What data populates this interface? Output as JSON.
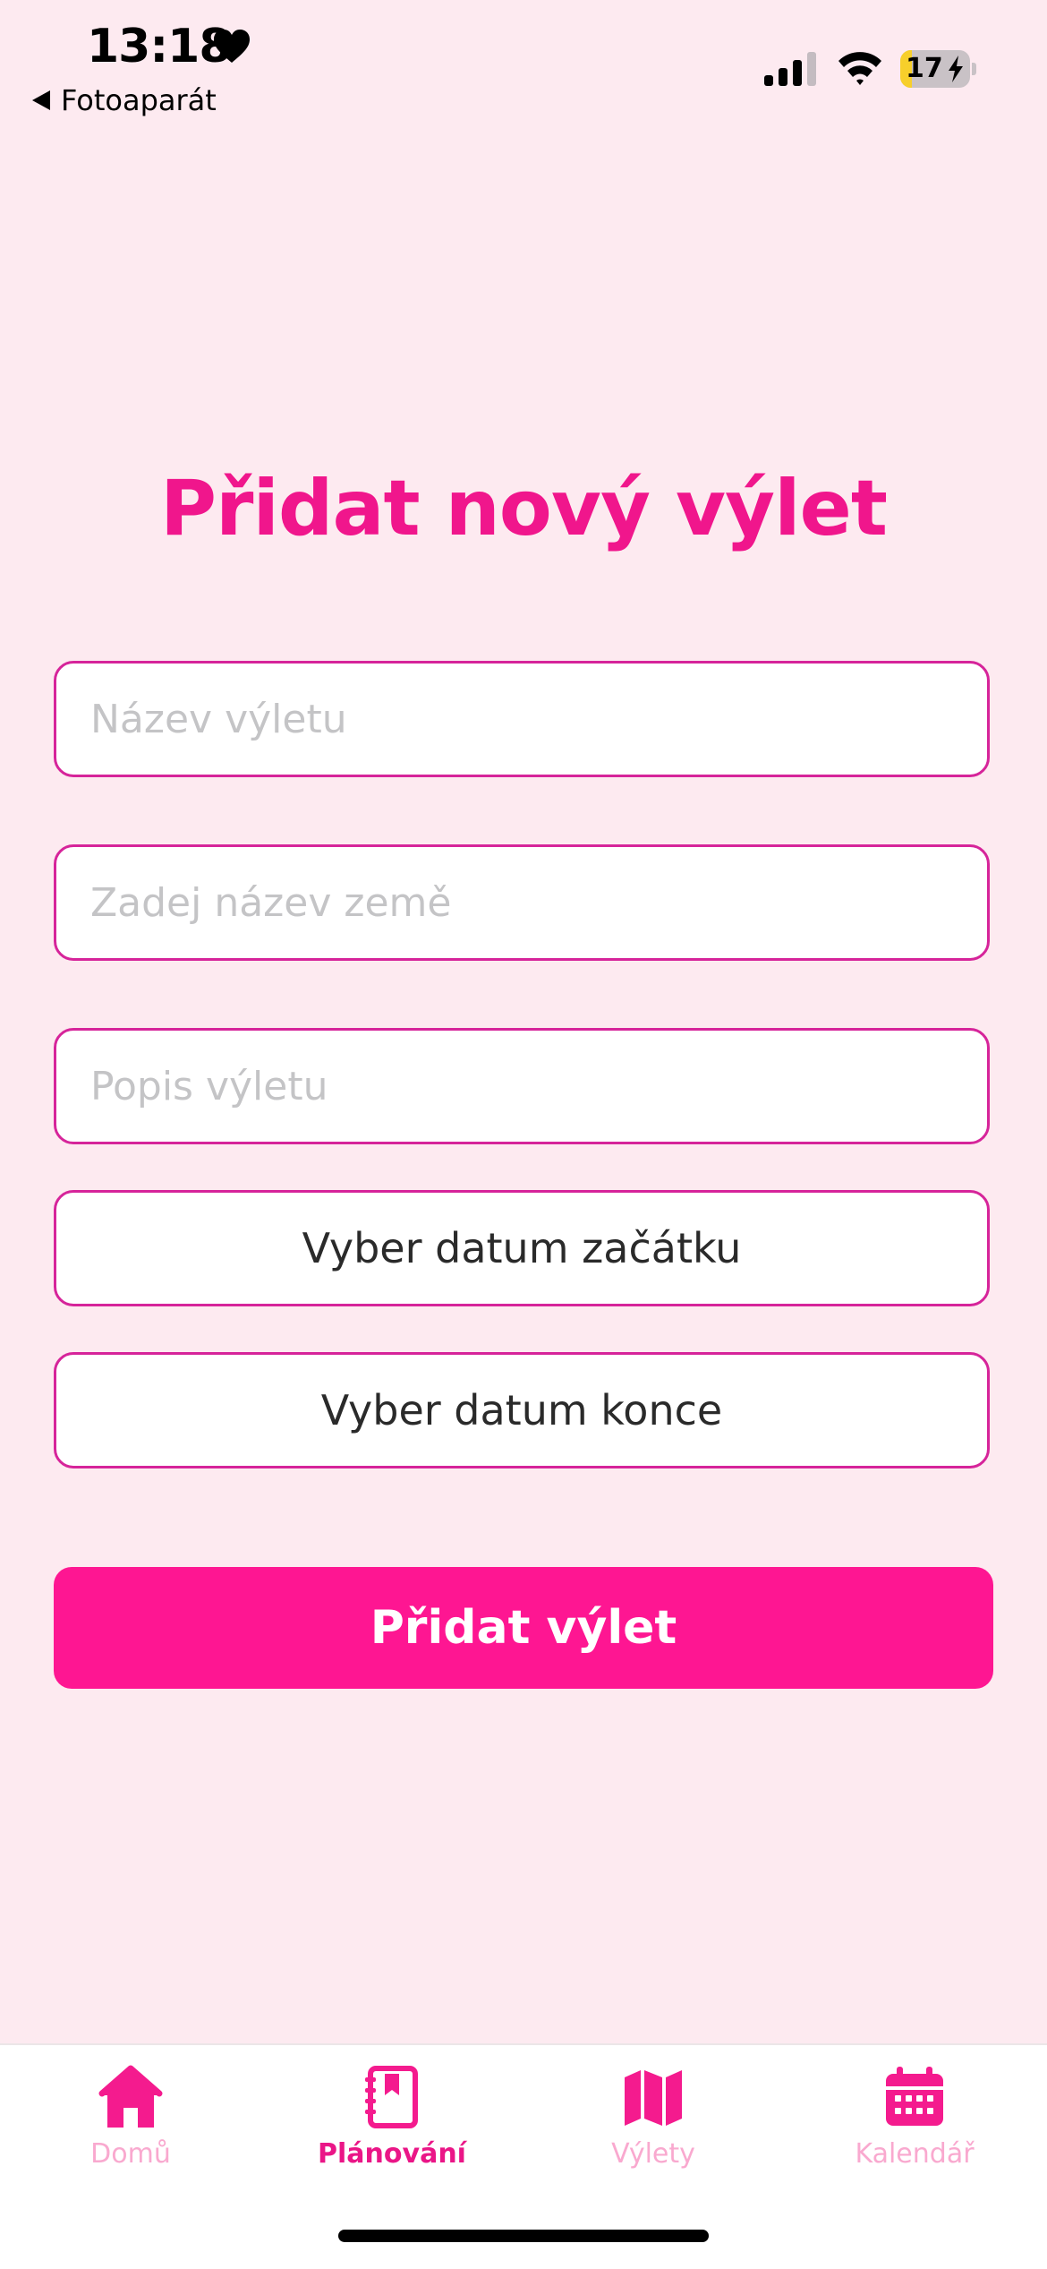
{
  "status_bar": {
    "time": "13:18",
    "back_label": "Fotoaparát",
    "battery_level": "17",
    "battery_fraction": 0.17
  },
  "main": {
    "title": "Přidat nový výlet",
    "fields": {
      "trip_name_placeholder": "Název výletu",
      "country_placeholder": "Zadej název země",
      "description_placeholder": "Popis výletu"
    },
    "start_date_label": "Vyber datum začátku",
    "end_date_label": "Vyber datum konce",
    "submit_label": "Přidat výlet"
  },
  "tab_bar": {
    "tabs": [
      {
        "label": "Domů",
        "icon": "house-icon",
        "active": false
      },
      {
        "label": "Plánování",
        "icon": "planner-book-icon",
        "active": true
      },
      {
        "label": "Výlety",
        "icon": "map-icon",
        "active": false
      },
      {
        "label": "Kalendář",
        "icon": "calendar-icon",
        "active": false
      }
    ]
  },
  "colors": {
    "background": "#fdeaf0",
    "accent": "#f0168c",
    "button": "#fe1692",
    "field_border": "#d6249a",
    "tab_inactive_label": "#f9a9cf"
  }
}
